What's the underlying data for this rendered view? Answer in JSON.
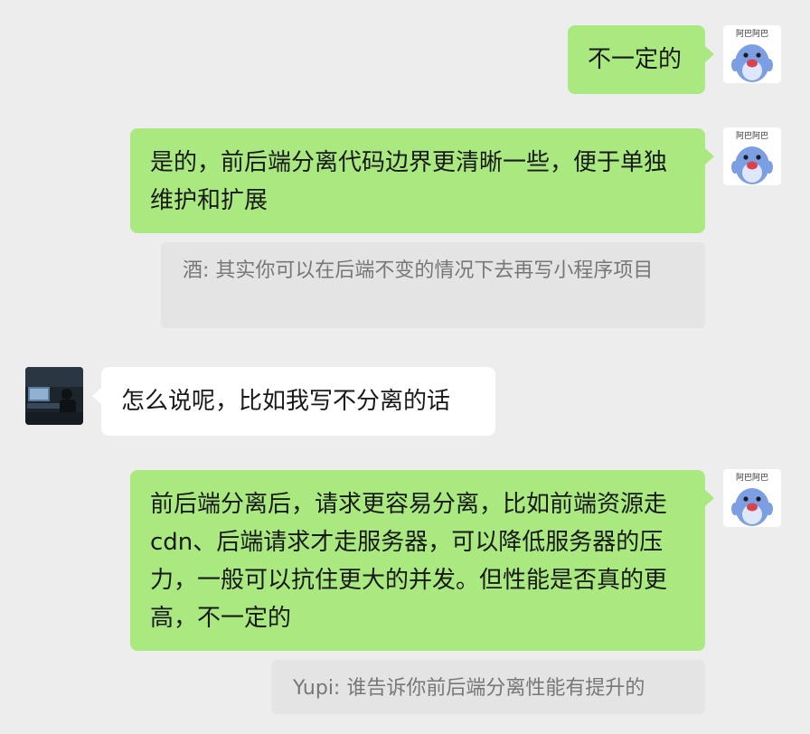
{
  "messages": [
    {
      "sender": "me",
      "text": "不一定的"
    },
    {
      "sender": "me",
      "text": "是的，前后端分离代码边界更清晰一些，便于单独维护和扩展",
      "quote": "酒: 其实你可以在后端不变的情况下去再写小程序项目"
    },
    {
      "sender": "other",
      "text": "怎么说呢，比如我写不分离的话"
    },
    {
      "sender": "me",
      "text": "前后端分离后，请求更容易分离，比如前端资源走 cdn、后端请求才走服务器，可以降低服务器的压力，一般可以抗住更大的并发。但性能是否真的更高，不一定的",
      "quote": "Yupi: 谁告诉你前后端分离性能有提升的"
    }
  ],
  "avatar_caption": "阿巴阿巴",
  "colors": {
    "background": "#ededed",
    "my_bubble": "#a9e97f",
    "their_bubble": "#ffffff",
    "quote_bg": "#e4e4e4",
    "quote_text": "#777777"
  }
}
